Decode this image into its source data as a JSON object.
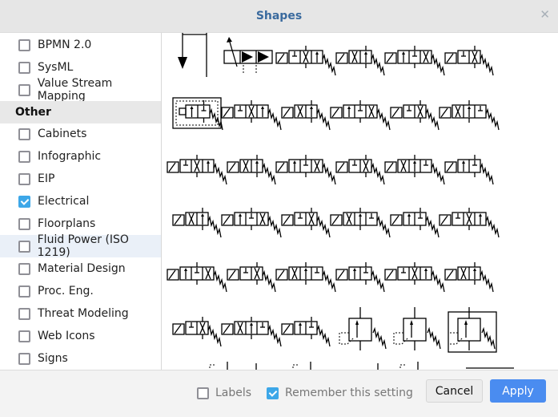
{
  "dialog": {
    "title": "Shapes",
    "close_icon": "close-x-icon"
  },
  "sidebar": {
    "items": [
      {
        "type": "checkbox",
        "label": "BPMN 2.0",
        "checked": false
      },
      {
        "type": "checkbox",
        "label": "SysML",
        "checked": false
      },
      {
        "type": "checkbox",
        "label": "Value Stream Mapping",
        "checked": false
      },
      {
        "type": "group",
        "label": "Other"
      },
      {
        "type": "checkbox",
        "label": "Cabinets",
        "checked": false
      },
      {
        "type": "checkbox",
        "label": "Infographic",
        "checked": false
      },
      {
        "type": "checkbox",
        "label": "EIP",
        "checked": false
      },
      {
        "type": "checkbox",
        "label": "Electrical",
        "checked": true
      },
      {
        "type": "checkbox",
        "label": "Floorplans",
        "checked": false
      },
      {
        "type": "checkbox",
        "label": "Fluid Power (ISO 1219)",
        "checked": false,
        "highlighted": true
      },
      {
        "type": "checkbox",
        "label": "Material Design",
        "checked": false
      },
      {
        "type": "checkbox",
        "label": "Proc. Eng.",
        "checked": false
      },
      {
        "type": "checkbox",
        "label": "Threat Modeling",
        "checked": false
      },
      {
        "type": "checkbox",
        "label": "Web Icons",
        "checked": false
      },
      {
        "type": "checkbox",
        "label": "Signs",
        "checked": false
      }
    ]
  },
  "preview": {
    "description": "Fluid Power (ISO 1219) shape previews",
    "rows": [
      [
        "cylinder-arrow",
        "solenoid-valve-filled",
        "plunger-valve",
        "solenoid-valve-2pos",
        "solenoid-valve-cross",
        "solenoid-pilot-valve"
      ],
      [
        "pressure-valve-box",
        "lock-valve",
        "roller-lever-valve",
        "solenoid-valve-3way",
        "solenoid-manual-valve",
        "pilot-check-valve"
      ],
      [
        "double-pilot-valve",
        "manual-cross-valve",
        "solenoid-3pos-valve",
        "check-valve",
        "solenoid-cross-valve",
        "multi-valve"
      ],
      [
        "spring-3pos-valve",
        "pilot-flow-valve",
        "dual-pilot-valve",
        "lever-5way-valve",
        "roller-5way-valve",
        "treadle-valve"
      ],
      [
        "sol-5way-a",
        "sol-5way-b",
        "sol-5way-c",
        "sol-5way-d",
        "sol-5way-e",
        "pilot-5way-valve"
      ],
      [
        "small-valve",
        "check-valve-gauge",
        "double-check-valve",
        "pressure-relief-valve",
        "pressure-relief-drain",
        "pressure-reducing-valve"
      ]
    ]
  },
  "footer": {
    "labels_option": {
      "label": "Labels",
      "checked": false
    },
    "remember_option": {
      "label": "Remember this setting",
      "checked": true
    },
    "cancel_label": "Cancel",
    "apply_label": "Apply"
  }
}
